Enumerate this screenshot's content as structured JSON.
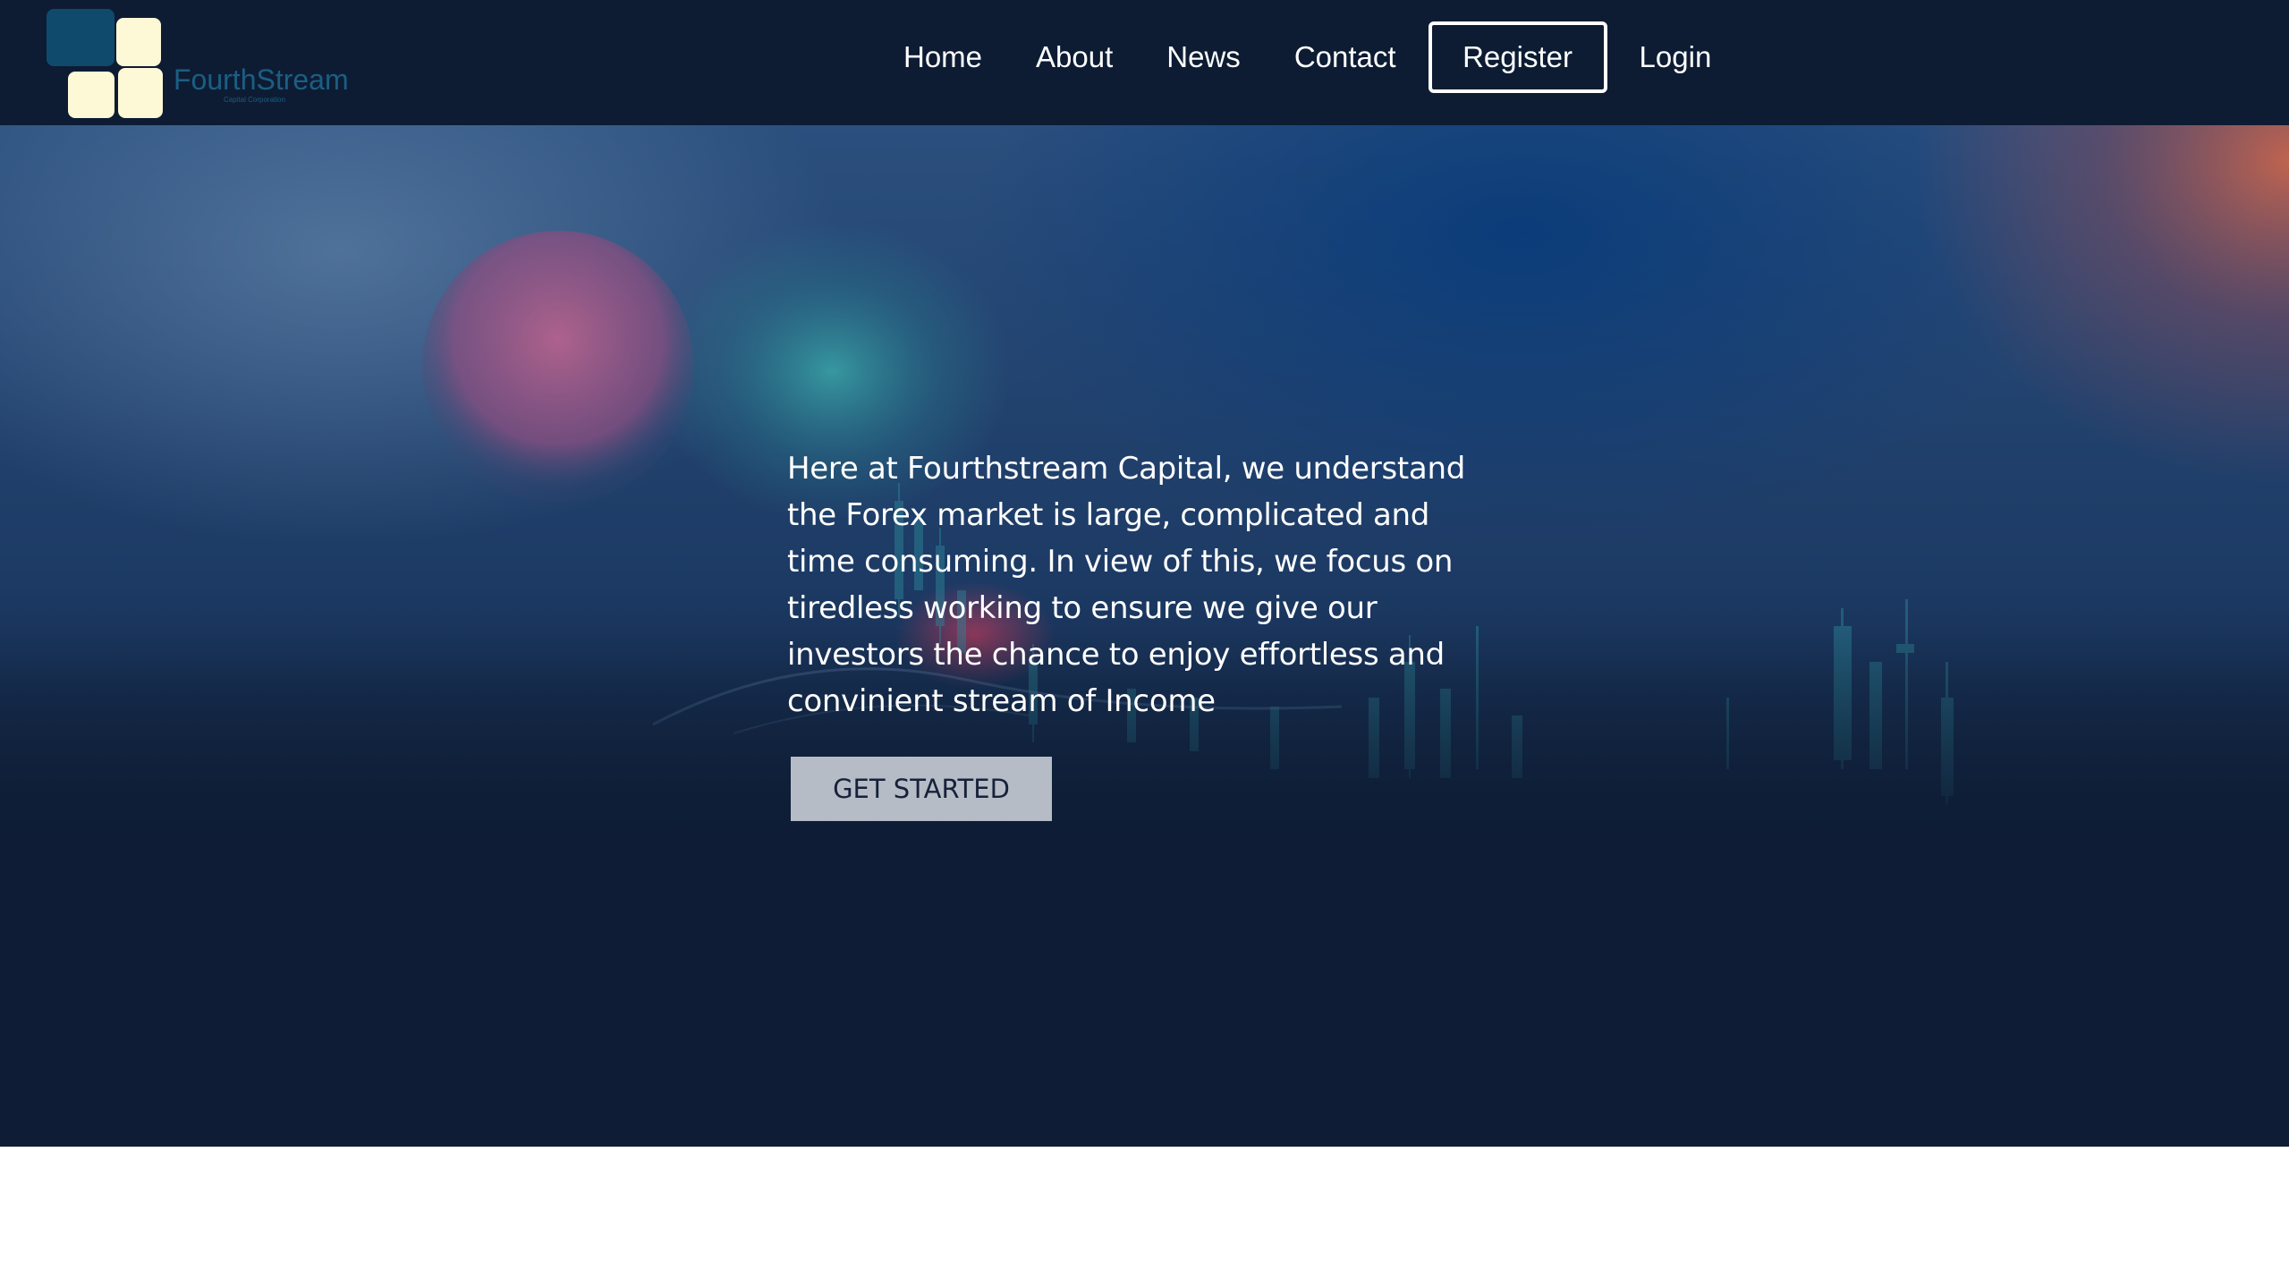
{
  "brand": {
    "name": "FourthStream",
    "tagline": "Capital Corporation",
    "colors": {
      "navy": "#0d1c33",
      "tile_cream": "#fdf8d6",
      "tile_teal": "#0f4a6d",
      "wordmark": "#1b5e83"
    }
  },
  "nav": {
    "items": [
      {
        "label": "Home"
      },
      {
        "label": "About"
      },
      {
        "label": "News"
      },
      {
        "label": "Contact"
      },
      {
        "label": "Register"
      },
      {
        "label": "Login"
      }
    ]
  },
  "hero": {
    "copy": "Here at Fourthstream Capital, we understand the Forex market is large, complicated and time consuming. In view of this, we focus on tiredless working to ensure we give our investors the chance to enjoy effortless and convinient stream of Income",
    "cta_label": "GET STARTED",
    "cta_color": "#b6bcc6"
  }
}
